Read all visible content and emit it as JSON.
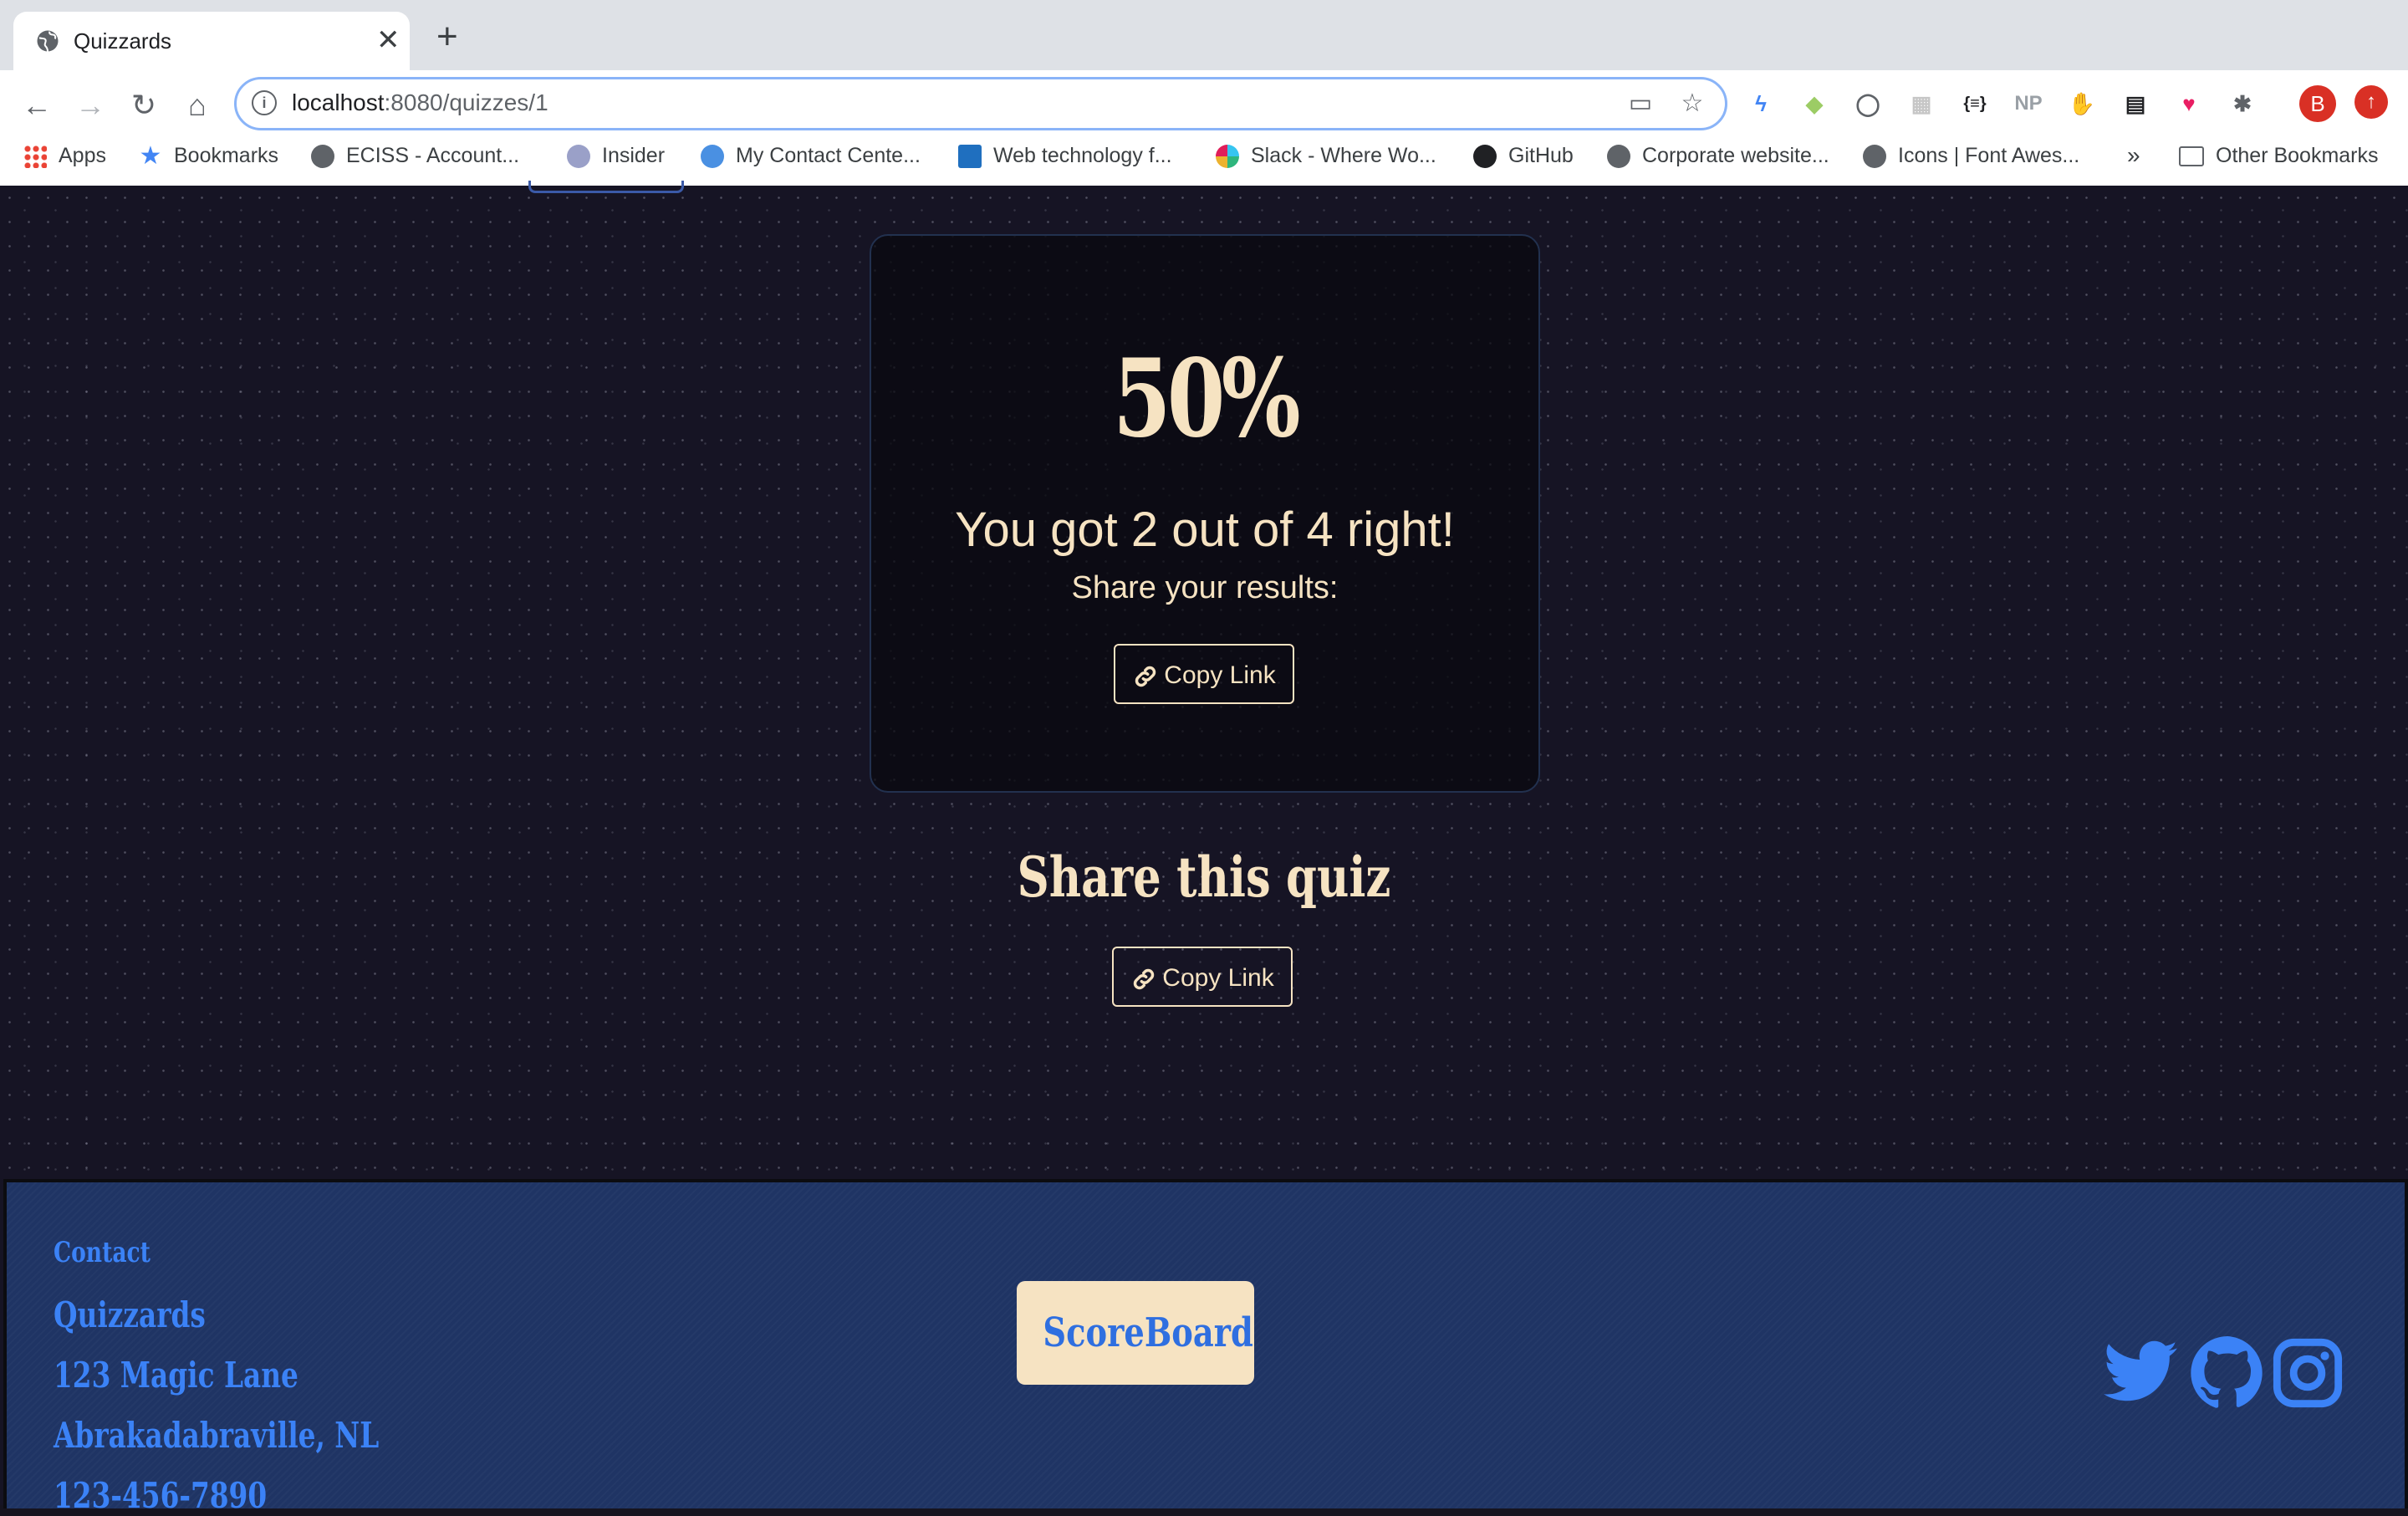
{
  "browser": {
    "tab_title": "Quizzards",
    "url_host": "localhost",
    "url_rest": ":8080/quizzes/1",
    "avatar_letter": "B",
    "bookmarks": [
      {
        "label": "Apps",
        "icon": "apps-grid-icon"
      },
      {
        "label": "Bookmarks",
        "icon": "star-icon"
      },
      {
        "label": "ECISS - Account...",
        "icon": "globe-icon"
      },
      {
        "label": "Insider",
        "icon": "wordpress-icon"
      },
      {
        "label": "My Contact Cente...",
        "icon": "agent-icon"
      },
      {
        "label": "Web technology f...",
        "icon": "mdn-icon"
      },
      {
        "label": "Slack - Where Wo...",
        "icon": "slack-icon"
      },
      {
        "label": "GitHub",
        "icon": "github-icon"
      },
      {
        "label": "Corporate website...",
        "icon": "globe-icon"
      },
      {
        "label": "Icons | Font Awes...",
        "icon": "globe-icon"
      }
    ],
    "overflow_label": "»",
    "other_bookmarks": "Other Bookmarks",
    "extensions": [
      "NP",
      "{≡}"
    ]
  },
  "result": {
    "percent": "50%",
    "summary": "You got 2 out of 4 right!",
    "share_prompt": "Share your results:",
    "copy_label": "Copy Link"
  },
  "share_quiz": {
    "title": "Share this quiz",
    "copy_label": "Copy Link"
  },
  "footer": {
    "contact_heading": "Contact",
    "name": "Quizzards",
    "street": "123 Magic Lane",
    "city": "Abrakadabraville, NL",
    "phone": "123-456-7890",
    "scoreboard_label": "ScoreBoard"
  },
  "colors": {
    "accent_cream": "#f6e3c2",
    "footer_blue": "#1f3464",
    "link_blue": "#3b82f6",
    "page_bg": "#161424"
  }
}
